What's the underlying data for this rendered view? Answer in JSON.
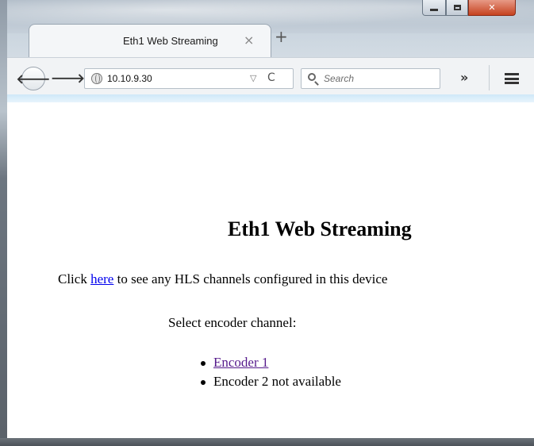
{
  "browser": {
    "tab_title": "Eth1 Web Streaming",
    "tab_close": "×",
    "new_tab": "+",
    "url": "10.10.9.30",
    "search_placeholder": "Search",
    "overflow": "»",
    "dropmarker": "▽",
    "reload": "C"
  },
  "page": {
    "heading": "Eth1 Web Streaming",
    "intro_prefix": "Click ",
    "intro_link": "here",
    "intro_suffix": " to see any HLS channels configured in this device",
    "select_label": "Select encoder channel:",
    "channels": [
      {
        "label": "Encoder 1",
        "link": true
      },
      {
        "label": "Encoder 2 not available",
        "link": false
      }
    ]
  }
}
